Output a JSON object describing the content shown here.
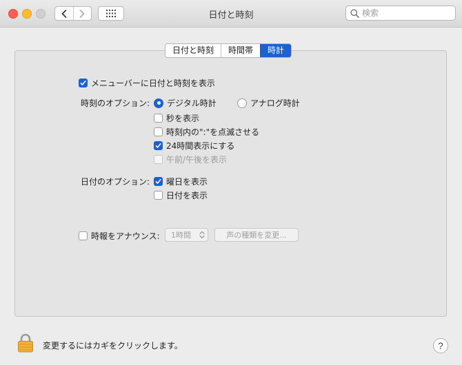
{
  "window": {
    "title": "日付と時刻",
    "search_placeholder": "検索"
  },
  "tabs": [
    {
      "label": "日付と時刻",
      "active": false
    },
    {
      "label": "時間帯",
      "active": false
    },
    {
      "label": "時計",
      "active": true
    }
  ],
  "clock": {
    "show_in_menubar": {
      "label": "メニューバーに日付と時刻を表示",
      "checked": true
    },
    "time_options_label": "時刻のオプション:",
    "digital": {
      "label": "デジタル時計",
      "selected": true
    },
    "analog": {
      "label": "アナログ時計",
      "selected": false
    },
    "show_seconds": {
      "label": "秒を表示",
      "checked": false
    },
    "flash_separators": {
      "label": "時刻内の\":\"を点滅させる",
      "checked": false
    },
    "use_24_hour": {
      "label": "24時間表示にする",
      "checked": true
    },
    "show_am_pm": {
      "label": "午前/午後を表示",
      "checked": false,
      "disabled": true
    },
    "date_options_label": "日付のオプション:",
    "show_day_of_week": {
      "label": "曜日を表示",
      "checked": true
    },
    "show_date": {
      "label": "日付を表示",
      "checked": false
    },
    "announce_time": {
      "label": "時報をアナウンス:",
      "checked": false
    },
    "interval_value": "1時間",
    "customize_voice_label": "声の種類を変更..."
  },
  "footer": {
    "lock_text": "変更するにはカギをクリックします。",
    "help_label": "?"
  },
  "colors": {
    "accent": "#1a61d6",
    "close": "#ff5f57",
    "minimize": "#febc2e"
  }
}
